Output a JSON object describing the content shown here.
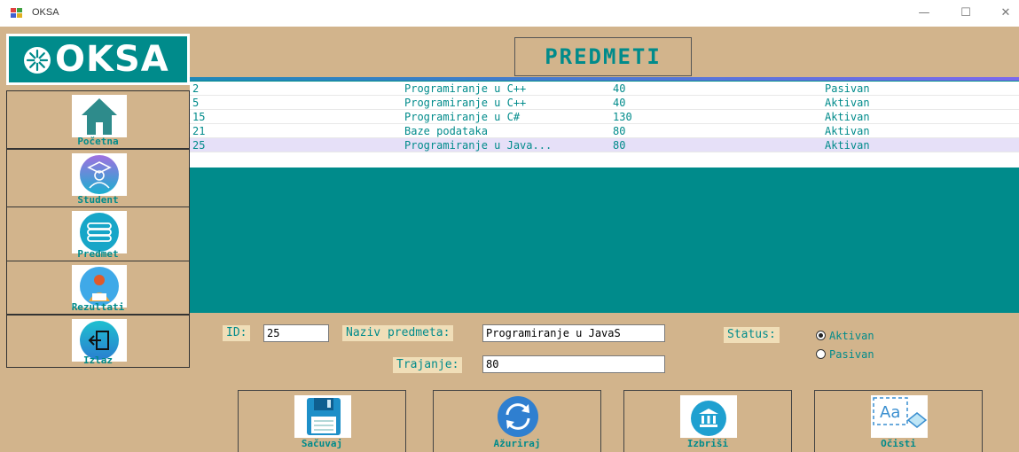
{
  "window": {
    "title": "OKSA",
    "minimize": "—",
    "maximize": "☐",
    "close": "✕"
  },
  "logo": {
    "text": "OKSA"
  },
  "header": {
    "title": "PREDMETI"
  },
  "nav": {
    "items": [
      {
        "label": "Početna",
        "icon": "home-icon"
      },
      {
        "label": "Student",
        "icon": "student-icon"
      },
      {
        "label": "Predmet",
        "icon": "books-icon"
      },
      {
        "label": "Rezultati",
        "icon": "results-icon"
      },
      {
        "label": "Izlaz",
        "icon": "exit-icon"
      }
    ]
  },
  "table": {
    "rows": [
      {
        "id": "2",
        "name": "Programiranje u C++",
        "duration": "40",
        "status": "Pasivan"
      },
      {
        "id": "5",
        "name": "Programiranje u C++",
        "duration": "40",
        "status": "Aktivan"
      },
      {
        "id": "15",
        "name": "Programiranje u C#",
        "duration": "130",
        "status": "Aktivan"
      },
      {
        "id": "21",
        "name": "Baze podataka",
        "duration": "80",
        "status": "Aktivan"
      },
      {
        "id": "25",
        "name": "Programiranje u Java...",
        "duration": "80",
        "status": "Aktivan"
      }
    ]
  },
  "form": {
    "id_label": "ID:",
    "id_value": "25",
    "name_label": "Naziv predmeta:",
    "name_value": "Programiranje u JavaS",
    "duration_label": "Trajanje:",
    "duration_value": "80",
    "status_label": "Status:",
    "status_options": [
      "Aktivan",
      "Pasivan"
    ],
    "status_selected": "Aktivan"
  },
  "actions": {
    "save": "Sačuvaj",
    "update": "Ažuriraj",
    "delete": "Izbriši",
    "clear": "Očisti"
  },
  "colors": {
    "accent": "#008b8b",
    "background": "#d2b48c",
    "selected_row": "#e6e0f8"
  }
}
